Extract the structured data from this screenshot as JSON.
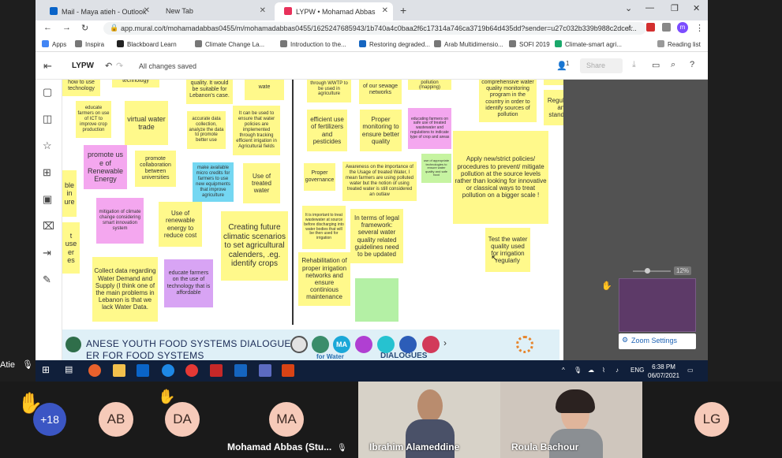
{
  "browser": {
    "tabs": [
      {
        "title": "Mail - Maya atieh - Outlook",
        "color": "#0a64c8"
      },
      {
        "title": "New Tab",
        "color": "#ffffff"
      },
      {
        "title": "LYPW • Mohamad Abbas",
        "color": "#e8315b"
      }
    ],
    "url": "app.mural.co/t/mohamadabbas0455/m/mohamadabbas0455/1625247685943/1b740a4c0baa2f6c17314a746ca3719b64d435dd?sender=u27c032b339b988c2dcef...",
    "bookmarks": [
      "Apps",
      "Inspira",
      "Blackboard Learn",
      "Climate Change La...",
      "Introduction to the...",
      "Restoring degraded...",
      "Arab Multidimensio...",
      "SOFI 2019",
      "Climate-smart agri...",
      "Reading list"
    ]
  },
  "mural": {
    "board_title": "LYPW",
    "save_status": "All changes saved",
    "share_label": "Share",
    "user_count": "1",
    "zoom_level": "12%",
    "zoom_settings_label": "Zoom Settings",
    "banner_text_1": "ANESE YOUTH FOOD SYSTEMS DIALOGUE:",
    "banner_text_2": "ER FOR FOOD SYSTEMS",
    "banner_dialogue": "DIALOGUES",
    "banner_water": "for Water",
    "banner_ma": "MA",
    "notes": [
      {
        "text": "how to use technology",
        "color": "yellow"
      },
      {
        "text": "technology",
        "color": "yellow"
      },
      {
        "text": "quality. It would be suitable for Lebanon's case.",
        "color": "yellow"
      },
      {
        "text": "wate",
        "color": "yellow"
      },
      {
        "text": "through WWTP to be used in agriculture",
        "color": "yellow"
      },
      {
        "text": "of our sewage networks",
        "color": "yellow"
      },
      {
        "text": "factors for water pollution (mapping)",
        "color": "yellow"
      },
      {
        "text": "comprehensive water quality monitoring program in the country in order to identify sources of pollution",
        "color": "yellow"
      },
      {
        "text": "educate farmers on use of ICT to improve crop production",
        "color": "yellow"
      },
      {
        "text": "virtual water trade",
        "color": "yellow"
      },
      {
        "text": "accurate data collection, analyze the data to promote better use",
        "color": "yellow"
      },
      {
        "text": "It can be used to ensure that water policies are implemented through tracking efficient irrigation in Agricultural fields",
        "color": "yellow"
      },
      {
        "text": "efficient use of fertilizers and pesticides",
        "color": "yellow"
      },
      {
        "text": "Proper monitoring to ensure better quality",
        "color": "yellow"
      },
      {
        "text": "educating farmers on safe use of treated wastewater and regulations to indicate type of crop and areas",
        "color": "pink"
      },
      {
        "text": "Regulation and standards",
        "color": "yellow"
      },
      {
        "text": "promote us e of Renewable Energy",
        "color": "pink"
      },
      {
        "text": "promote collaboration between universities",
        "color": "yellow"
      },
      {
        "text": "make available micro credits for farmers to use new equipments that improve agriculture",
        "color": "blue"
      },
      {
        "text": "Use of treated water",
        "color": "yellow"
      },
      {
        "text": "Proper governance",
        "color": "yellow"
      },
      {
        "text": "Awareness on the importance of the Usage of treated Water, I mean farmers are using polluted water but the notion of using treated water is still considered an outlaw",
        "color": "yellow"
      },
      {
        "text": "use of appropriate technologies to ensure water quality and safe food",
        "color": "green"
      },
      {
        "text": "Apply new/strict policies/ procedures to prevent/ mitigate pollution at the source levels rather than looking for innovative or classical ways to treat pollution on a bigger scale !",
        "color": "yellow"
      },
      {
        "text": "ble in ure",
        "color": "yellow"
      },
      {
        "text": "mitigation of climate change considering smart innovation system",
        "color": "pink"
      },
      {
        "text": "Use of renewable energy to reduce cost",
        "color": "yellow"
      },
      {
        "text": "Creating future climatic scenarios to set agricultural calenders, .eg. identify crops",
        "color": "yellow"
      },
      {
        "text": "It is important to treat wastewater at source before discharging into water bodies that will be then used for irrigation",
        "color": "yellow"
      },
      {
        "text": "In terms of legal framework: several water quality related guidelines need to be updated",
        "color": "yellow"
      },
      {
        "text": "Test the water quality used for irrigation regularly",
        "color": "yellow"
      },
      {
        "text": "t use er es",
        "color": "yellow"
      },
      {
        "text": "Collect data regarding Water Demand and Supply (I think one of the main problems in Lebanon is that we lack Water Data.",
        "color": "yellow"
      },
      {
        "text": "educate farmers on the use of technology that is affordable",
        "color": "lilac"
      },
      {
        "text": "Rehabilitation of proper irrigation networks and ensure continious maintenance",
        "color": "yellow"
      },
      {
        "text": "",
        "color": "mint"
      }
    ]
  },
  "taskbar": {
    "lang": "ENG",
    "time": "6:38 PM",
    "date": "06/07/2021"
  },
  "meeting": {
    "left_name": "Atie",
    "more_count": "+18",
    "participants": [
      {
        "initials": "AB",
        "name": ""
      },
      {
        "initials": "DA",
        "name": ""
      },
      {
        "initials": "MA",
        "name": "Mohamad Abbas (Stu..."
      },
      {
        "initials": "",
        "name": "Ibrahim Alameddine"
      },
      {
        "initials": "",
        "name": "Roula Bachour"
      },
      {
        "initials": "LG",
        "name": ""
      }
    ]
  }
}
